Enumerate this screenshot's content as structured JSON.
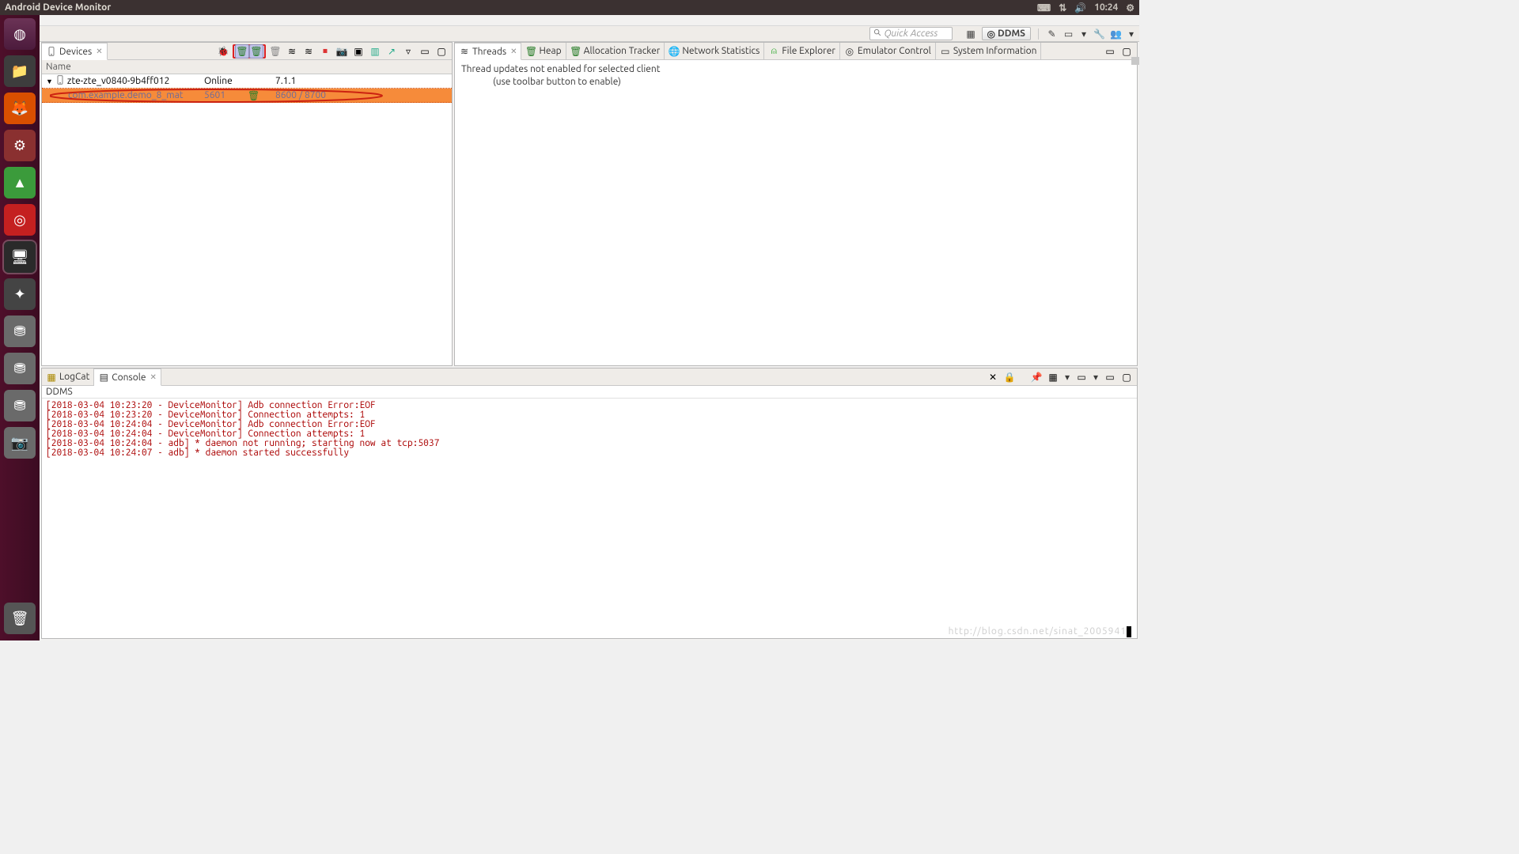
{
  "topbar": {
    "title": "Android Device Monitor",
    "time": "10:24"
  },
  "quick_access": {
    "placeholder": "Quick Access"
  },
  "perspective": {
    "label": "DDMS"
  },
  "devices": {
    "tab_label": "Devices",
    "header": {
      "name": "Name"
    },
    "device_row": {
      "name": "zte-zte_v0840-9b4ff012",
      "status": "Online",
      "version": "7.1.1"
    },
    "process_row": {
      "name": "com.example.demo_8_mat",
      "pid": "5601",
      "ports": "8600 / 8700"
    }
  },
  "right_tabs": {
    "items": [
      {
        "label": "Threads"
      },
      {
        "label": "Heap"
      },
      {
        "label": "Allocation Tracker"
      },
      {
        "label": "Network Statistics"
      },
      {
        "label": "File Explorer"
      },
      {
        "label": "Emulator Control"
      },
      {
        "label": "System Information"
      }
    ],
    "msg_line1": "Thread updates not enabled for selected client",
    "msg_line2": "(use toolbar button to enable)"
  },
  "bottom_tabs": {
    "logcat": "LogCat",
    "console": "Console"
  },
  "console": {
    "title": "DDMS",
    "lines": [
      "[2018-03-04 10:23:20 - DeviceMonitor] Adb connection Error:EOF",
      "[2018-03-04 10:23:20 - DeviceMonitor] Connection attempts: 1",
      "[2018-03-04 10:24:04 - DeviceMonitor] Adb connection Error:EOF",
      "[2018-03-04 10:24:04 - DeviceMonitor] Connection attempts: 1",
      "[2018-03-04 10:24:04 - adb] * daemon not running; starting now at tcp:5037",
      "[2018-03-04 10:24:07 - adb] * daemon started successfully"
    ]
  },
  "watermark": "http://blog.csdn.net/sinat_2005941"
}
